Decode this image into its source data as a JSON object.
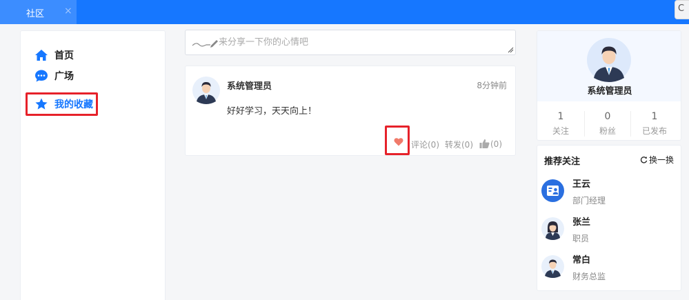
{
  "tab": {
    "label": "社区",
    "close": "×"
  },
  "topright": {
    "label": "C"
  },
  "nav": [
    {
      "label": "首页",
      "icon": "home-icon"
    },
    {
      "label": "广场",
      "icon": "chat-bubble-icon"
    },
    {
      "label": "我的收藏",
      "icon": "star-icon"
    }
  ],
  "compose": {
    "placeholder": "来分享一下你的心情吧"
  },
  "post": {
    "author": "系统管理员",
    "time": "8分钟前",
    "content": "好好学习，天天向上！",
    "comment_label": "评论(0)",
    "share_label": "转发(0)",
    "like_count": "(0)"
  },
  "profile": {
    "name": "系统管理员",
    "stats": [
      {
        "value": "1",
        "label": "关注"
      },
      {
        "value": "0",
        "label": "粉丝"
      },
      {
        "value": "1",
        "label": "已发布"
      }
    ]
  },
  "recommend": {
    "title": "推荐关注",
    "refresh_label": "换一换",
    "users": [
      {
        "name": "王云",
        "role": "部门经理"
      },
      {
        "name": "张兰",
        "role": "职员"
      },
      {
        "name": "常白",
        "role": "财务总监"
      }
    ]
  },
  "colors": {
    "primary": "#1677ff",
    "highlight": "#e6212a",
    "heart": "#f07a6a"
  }
}
